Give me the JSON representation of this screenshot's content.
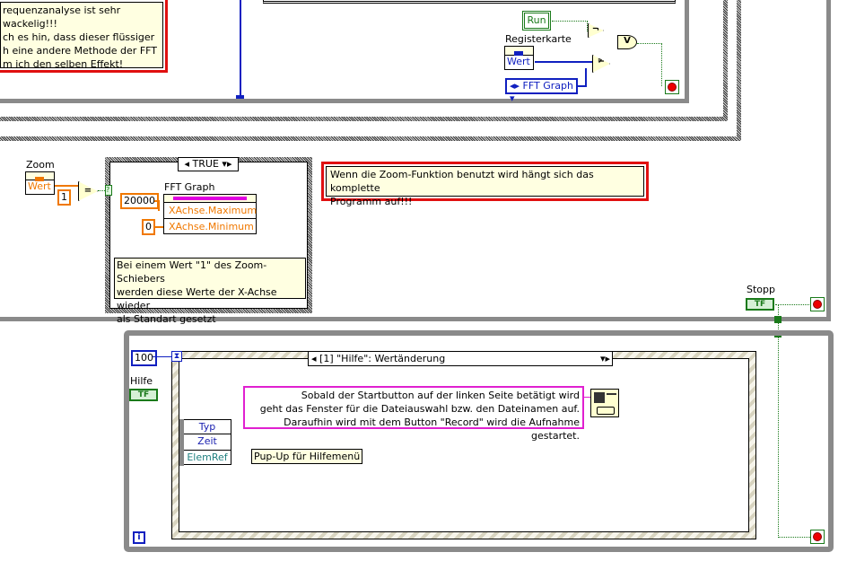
{
  "top_note": {
    "lines": [
      "requenzanalyse ist sehr wackelig!!!",
      "ch es hin, dass dieser flüssiger",
      "h eine andere Methode der FFT",
      "m ich den selben Effekt!"
    ]
  },
  "top_loop": {
    "run_label": "Run",
    "registerkarte_label": "Registerkarte",
    "wert_label": "Wert",
    "fft_graph_enum": "FFT Graph",
    "not_symbol": "¬",
    "or_symbol": "V",
    "neq_symbol": "≠"
  },
  "zoom_section": {
    "zoom_label": "Zoom",
    "wert_label": "Wert",
    "const_one": "1",
    "eq_symbol": "=",
    "case_selector": "TRUE",
    "fft_graph_label": "FFT Graph",
    "const_max": "20000",
    "const_min": "0",
    "prop_max": "XAchse.Maximum",
    "prop_min": "XAchse.Minimum",
    "case_note_lines": [
      "Bei einem Wert \"1\" des Zoom-Schiebers",
      "werden diese Werte der X-Achse wieder",
      "als Standart gesetzt"
    ],
    "zoom_note_lines": [
      "Wenn die Zoom-Funktion benutzt wird hängt sich das komplette",
      "Programm auf!!!"
    ]
  },
  "stopp": {
    "label": "Stopp",
    "tf": "TF"
  },
  "bottom_loop": {
    "timeout_const": "100",
    "hilfe_label": "Hilfe",
    "hilfe_tf": "TF",
    "event_selector": "[1] \"Hilfe\": Wertänderung",
    "event_data": [
      "Typ",
      "Zeit",
      "ElemRef"
    ],
    "help_note_lines": [
      "Sobald der Startbutton auf der linken Seite betätigt wird",
      "geht das Fenster für die Dateiauswahl bzw. den Dateinamen auf.",
      "Daraufhin wird mit dem Button \"Record\" wird die Aufnahme gestartet."
    ],
    "popup_label": "Pup-Up für Hilfemenü",
    "iteration": "i"
  }
}
